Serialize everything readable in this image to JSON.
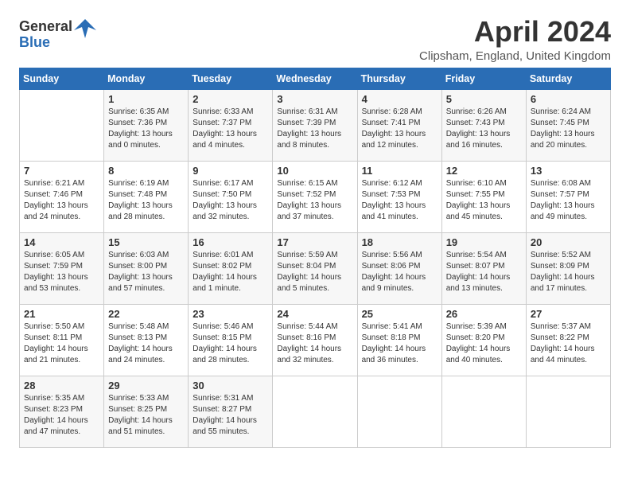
{
  "header": {
    "logo_general": "General",
    "logo_blue": "Blue",
    "title": "April 2024",
    "location": "Clipsham, England, United Kingdom"
  },
  "weekdays": [
    "Sunday",
    "Monday",
    "Tuesday",
    "Wednesday",
    "Thursday",
    "Friday",
    "Saturday"
  ],
  "weeks": [
    [
      {
        "day": "",
        "info": ""
      },
      {
        "day": "1",
        "info": "Sunrise: 6:35 AM\nSunset: 7:36 PM\nDaylight: 13 hours\nand 0 minutes."
      },
      {
        "day": "2",
        "info": "Sunrise: 6:33 AM\nSunset: 7:37 PM\nDaylight: 13 hours\nand 4 minutes."
      },
      {
        "day": "3",
        "info": "Sunrise: 6:31 AM\nSunset: 7:39 PM\nDaylight: 13 hours\nand 8 minutes."
      },
      {
        "day": "4",
        "info": "Sunrise: 6:28 AM\nSunset: 7:41 PM\nDaylight: 13 hours\nand 12 minutes."
      },
      {
        "day": "5",
        "info": "Sunrise: 6:26 AM\nSunset: 7:43 PM\nDaylight: 13 hours\nand 16 minutes."
      },
      {
        "day": "6",
        "info": "Sunrise: 6:24 AM\nSunset: 7:45 PM\nDaylight: 13 hours\nand 20 minutes."
      }
    ],
    [
      {
        "day": "7",
        "info": "Sunrise: 6:21 AM\nSunset: 7:46 PM\nDaylight: 13 hours\nand 24 minutes."
      },
      {
        "day": "8",
        "info": "Sunrise: 6:19 AM\nSunset: 7:48 PM\nDaylight: 13 hours\nand 28 minutes."
      },
      {
        "day": "9",
        "info": "Sunrise: 6:17 AM\nSunset: 7:50 PM\nDaylight: 13 hours\nand 32 minutes."
      },
      {
        "day": "10",
        "info": "Sunrise: 6:15 AM\nSunset: 7:52 PM\nDaylight: 13 hours\nand 37 minutes."
      },
      {
        "day": "11",
        "info": "Sunrise: 6:12 AM\nSunset: 7:53 PM\nDaylight: 13 hours\nand 41 minutes."
      },
      {
        "day": "12",
        "info": "Sunrise: 6:10 AM\nSunset: 7:55 PM\nDaylight: 13 hours\nand 45 minutes."
      },
      {
        "day": "13",
        "info": "Sunrise: 6:08 AM\nSunset: 7:57 PM\nDaylight: 13 hours\nand 49 minutes."
      }
    ],
    [
      {
        "day": "14",
        "info": "Sunrise: 6:05 AM\nSunset: 7:59 PM\nDaylight: 13 hours\nand 53 minutes."
      },
      {
        "day": "15",
        "info": "Sunrise: 6:03 AM\nSunset: 8:00 PM\nDaylight: 13 hours\nand 57 minutes."
      },
      {
        "day": "16",
        "info": "Sunrise: 6:01 AM\nSunset: 8:02 PM\nDaylight: 14 hours\nand 1 minute."
      },
      {
        "day": "17",
        "info": "Sunrise: 5:59 AM\nSunset: 8:04 PM\nDaylight: 14 hours\nand 5 minutes."
      },
      {
        "day": "18",
        "info": "Sunrise: 5:56 AM\nSunset: 8:06 PM\nDaylight: 14 hours\nand 9 minutes."
      },
      {
        "day": "19",
        "info": "Sunrise: 5:54 AM\nSunset: 8:07 PM\nDaylight: 14 hours\nand 13 minutes."
      },
      {
        "day": "20",
        "info": "Sunrise: 5:52 AM\nSunset: 8:09 PM\nDaylight: 14 hours\nand 17 minutes."
      }
    ],
    [
      {
        "day": "21",
        "info": "Sunrise: 5:50 AM\nSunset: 8:11 PM\nDaylight: 14 hours\nand 21 minutes."
      },
      {
        "day": "22",
        "info": "Sunrise: 5:48 AM\nSunset: 8:13 PM\nDaylight: 14 hours\nand 24 minutes."
      },
      {
        "day": "23",
        "info": "Sunrise: 5:46 AM\nSunset: 8:15 PM\nDaylight: 14 hours\nand 28 minutes."
      },
      {
        "day": "24",
        "info": "Sunrise: 5:44 AM\nSunset: 8:16 PM\nDaylight: 14 hours\nand 32 minutes."
      },
      {
        "day": "25",
        "info": "Sunrise: 5:41 AM\nSunset: 8:18 PM\nDaylight: 14 hours\nand 36 minutes."
      },
      {
        "day": "26",
        "info": "Sunrise: 5:39 AM\nSunset: 8:20 PM\nDaylight: 14 hours\nand 40 minutes."
      },
      {
        "day": "27",
        "info": "Sunrise: 5:37 AM\nSunset: 8:22 PM\nDaylight: 14 hours\nand 44 minutes."
      }
    ],
    [
      {
        "day": "28",
        "info": "Sunrise: 5:35 AM\nSunset: 8:23 PM\nDaylight: 14 hours\nand 47 minutes."
      },
      {
        "day": "29",
        "info": "Sunrise: 5:33 AM\nSunset: 8:25 PM\nDaylight: 14 hours\nand 51 minutes."
      },
      {
        "day": "30",
        "info": "Sunrise: 5:31 AM\nSunset: 8:27 PM\nDaylight: 14 hours\nand 55 minutes."
      },
      {
        "day": "",
        "info": ""
      },
      {
        "day": "",
        "info": ""
      },
      {
        "day": "",
        "info": ""
      },
      {
        "day": "",
        "info": ""
      }
    ]
  ]
}
